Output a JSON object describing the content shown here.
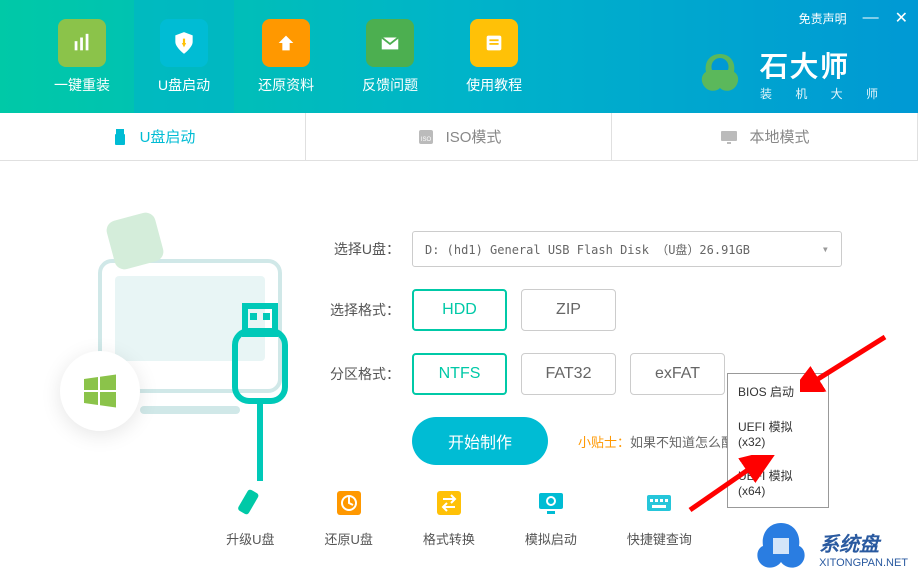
{
  "header": {
    "disclaimer": "免责声明",
    "tabs": [
      {
        "label": "一键重装",
        "icon": "bars"
      },
      {
        "label": "U盘启动",
        "icon": "shield",
        "active": true
      },
      {
        "label": "还原资料",
        "icon": "up"
      },
      {
        "label": "反馈问题",
        "icon": "mail"
      },
      {
        "label": "使用教程",
        "icon": "book"
      }
    ],
    "brand_title": "石大师",
    "brand_sub": "装 机 大 师"
  },
  "sub_tabs": [
    {
      "label": "U盘启动",
      "active": true
    },
    {
      "label": "ISO模式"
    },
    {
      "label": "本地模式"
    }
  ],
  "form": {
    "usb_label": "选择U盘：",
    "usb_value": "D: (hd1) General USB Flash Disk （U盘）26.91GB",
    "format_label": "选择格式：",
    "format_options": [
      "HDD",
      "ZIP"
    ],
    "format_selected": "HDD",
    "partition_label": "分区格式：",
    "partition_options": [
      "NTFS",
      "FAT32",
      "exFAT"
    ],
    "partition_selected": "NTFS",
    "start_btn": "开始制作",
    "tip_label": "小贴士：",
    "tip_text": "如果不知道怎么配置                      即可"
  },
  "popup": {
    "items": [
      "BIOS 启动",
      "UEFI 模拟(x32)",
      "UEFI 模拟(x64)"
    ]
  },
  "bottom_tools": [
    {
      "label": "升级U盘",
      "color": "#00c9a7"
    },
    {
      "label": "还原U盘",
      "color": "#ff9800"
    },
    {
      "label": "格式转换",
      "color": "#ffc107"
    },
    {
      "label": "模拟启动",
      "color": "#00bcd4"
    },
    {
      "label": "快捷键查询",
      "color": "#26c6da"
    }
  ],
  "watermark": {
    "text": "系统盘",
    "url": "XITONGPAN.NET"
  }
}
